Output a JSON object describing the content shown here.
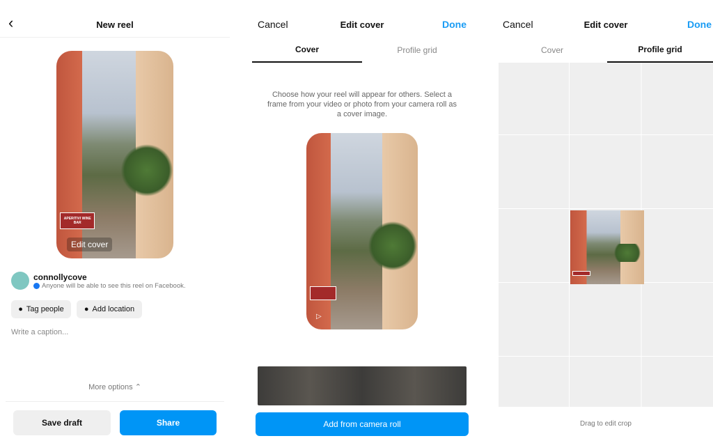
{
  "new_reel": {
    "title": "New reel",
    "edit_cover": "Edit cover",
    "username": "connollycove",
    "visibility": "Anyone will be able to see this reel on Facebook.",
    "tag_people": "Tag people",
    "add_location": "Add location",
    "caption_placeholder": "Write a caption...",
    "more_options": "More options",
    "save_draft": "Save draft",
    "share": "Share",
    "sign_text": "APERITIVI WINE BAR"
  },
  "edit_cover": {
    "cancel": "Cancel",
    "title": "Edit cover",
    "done": "Done",
    "tabs": [
      {
        "label": "Cover",
        "active": true
      },
      {
        "label": "Profile grid",
        "active": false
      }
    ],
    "description": "Choose how your reel will appear for others. Select a frame from your video or photo from your camera roll as a cover image.",
    "add_from_camera_roll": "Add from camera roll"
  },
  "edit_cover_grid": {
    "cancel": "Cancel",
    "title": "Edit cover",
    "done": "Done",
    "tabs": [
      {
        "label": "Cover",
        "active": false
      },
      {
        "label": "Profile grid",
        "active": true
      }
    ],
    "hint": "Drag to edit crop"
  },
  "colors": {
    "accent": "#1a9cf4",
    "button_blue": "#0095f6",
    "secondary_button": "#efefef"
  }
}
